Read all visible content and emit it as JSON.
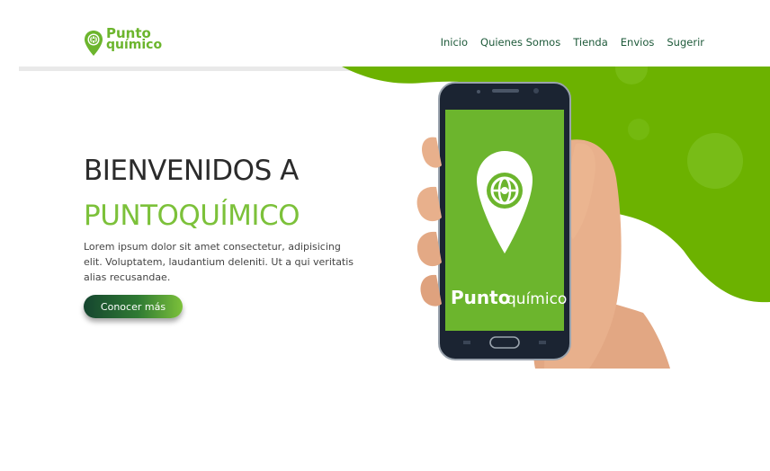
{
  "brand": {
    "line1": "Punto",
    "line2": "químico",
    "color": "#6cb52d"
  },
  "nav": {
    "items": [
      {
        "label": "Inicio"
      },
      {
        "label": "Quienes Somos"
      },
      {
        "label": "Tienda"
      },
      {
        "label": "Envios"
      },
      {
        "label": "Sugerir"
      }
    ]
  },
  "hero": {
    "title_line1": "BIENVENIDOS A",
    "title_line2": "PUNTOQUÍMICO",
    "description": "Lorem ipsum dolor sit amet consectetur, adipisicing elit. Voluptatem, laudantium deleniti. Ut a qui veritatis alias recusandae.",
    "cta_label": "Conocer más"
  },
  "phone": {
    "screen_brand_bold": "Punto",
    "screen_brand_light": "químico",
    "screen_color": "#6cb52d"
  },
  "colors": {
    "accent": "#7cc13a",
    "nav_text": "#1e5a3a",
    "button_start": "#15452f",
    "button_end": "#7cc13a"
  }
}
